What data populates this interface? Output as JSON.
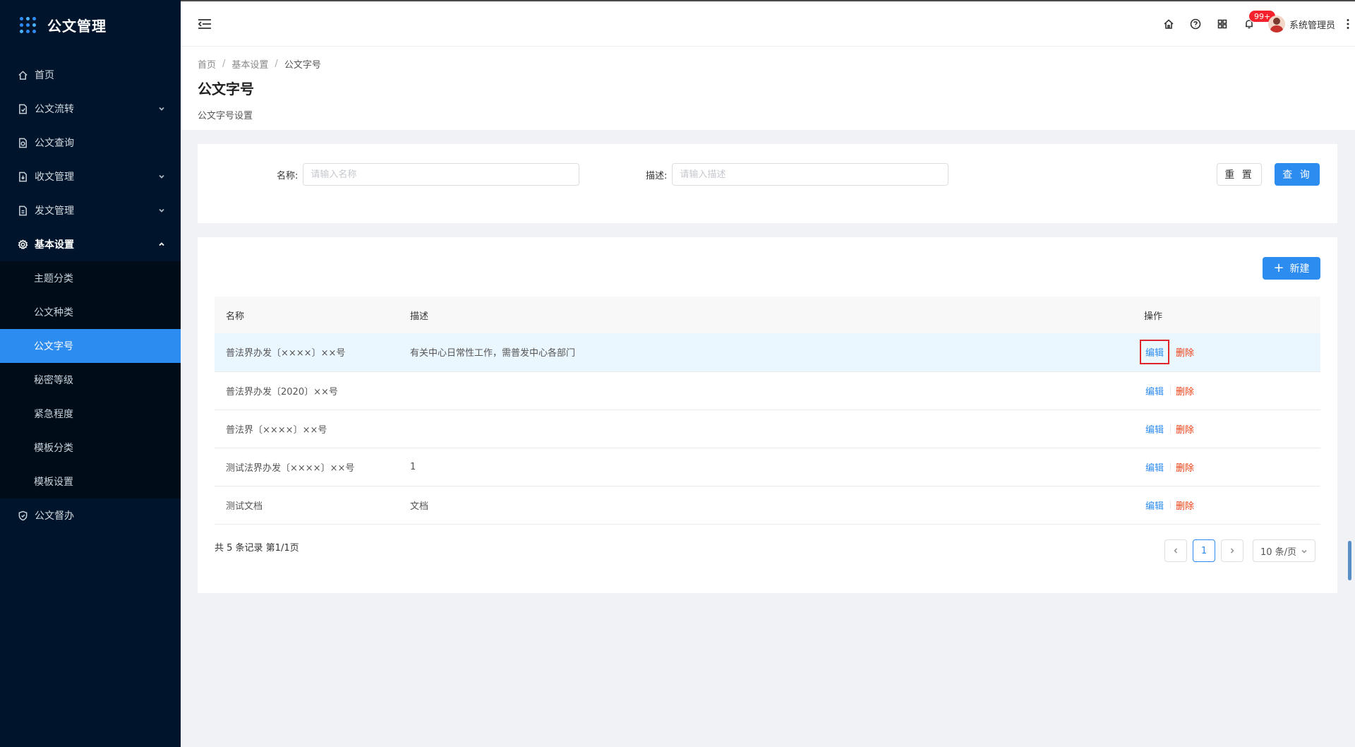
{
  "app": {
    "title": "公文管理"
  },
  "sidebar": {
    "items": [
      {
        "label": "首页",
        "icon": "home-icon",
        "expandable": false
      },
      {
        "label": "公文流转",
        "icon": "doc-flow-icon",
        "expandable": true
      },
      {
        "label": "公文查询",
        "icon": "doc-search-icon",
        "expandable": false
      },
      {
        "label": "收文管理",
        "icon": "doc-receive-icon",
        "expandable": true
      },
      {
        "label": "发文管理",
        "icon": "doc-send-icon",
        "expandable": true
      },
      {
        "label": "基本设置",
        "icon": "gear-icon",
        "expandable": true,
        "open": true
      },
      {
        "label": "公文督办",
        "icon": "shield-icon",
        "expandable": false
      }
    ],
    "submenu": [
      {
        "label": "主题分类"
      },
      {
        "label": "公文种类"
      },
      {
        "label": "公文字号",
        "active": true
      },
      {
        "label": "秘密等级"
      },
      {
        "label": "紧急程度"
      },
      {
        "label": "模板分类"
      },
      {
        "label": "模板设置"
      }
    ]
  },
  "header": {
    "notification_badge": "99+",
    "user_name": "系统管理员"
  },
  "breadcrumb": {
    "items": [
      "首页",
      "基本设置",
      "公文字号"
    ]
  },
  "page": {
    "title": "公文字号",
    "description": "公文字号设置"
  },
  "search": {
    "name_label": "名称:",
    "name_placeholder": "请输入名称",
    "name_value": "",
    "desc_label": "描述:",
    "desc_placeholder": "请输入描述",
    "desc_value": "",
    "reset_label": "重 置",
    "query_label": "查 询"
  },
  "toolbar": {
    "new_label": "新建"
  },
  "table": {
    "columns": [
      "名称",
      "描述",
      "操作"
    ],
    "rows": [
      {
        "name": "普法界办发〔××××〕××号",
        "description": "有关中心日常性工作，需普发中心各部门",
        "edit": "编辑",
        "delete": "删除"
      },
      {
        "name": "普法界办发〔2020〕××号",
        "description": "",
        "edit": "编辑",
        "delete": "删除"
      },
      {
        "name": "普法界〔××××〕××号",
        "description": "",
        "edit": "编辑",
        "delete": "删除"
      },
      {
        "name": "测试法界办发〔××××〕××号",
        "description": "1",
        "edit": "编辑",
        "delete": "删除"
      },
      {
        "name": "测试文档",
        "description": "文档",
        "edit": "编辑",
        "delete": "删除"
      }
    ]
  },
  "pagination": {
    "summary": "共 5 条记录 第1/1页",
    "current_page": "1",
    "page_size": "10 条/页"
  },
  "colors": {
    "primary": "#2d8cf0",
    "danger": "#ed4014",
    "sidebar_bg": "#00152b"
  }
}
